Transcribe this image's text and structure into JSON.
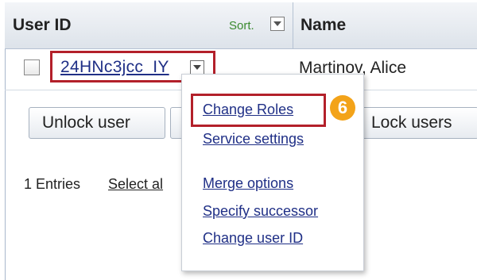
{
  "header": {
    "col_user_id": "User ID",
    "sort_label": "Sort.",
    "sort_icon": "dropdown-arrow-icon",
    "col_name": "Name"
  },
  "row": {
    "checkbox_checked": false,
    "user_id": "24HNc3jcc_IY",
    "user_id_menu_icon": "dropdown-arrow-icon",
    "name": "Martinov, Alice"
  },
  "buttons": {
    "unlock": "Unlock user",
    "lock": "Lock users"
  },
  "footer": {
    "entries": "1 Entries",
    "select_all": "Select al"
  },
  "context_menu": {
    "items": [
      "Change Roles",
      "Service settings",
      "Merge options",
      "Specify successor",
      "Change user ID"
    ]
  },
  "annotation": {
    "step": "6",
    "highlight_color": "#b3202a",
    "badge_color": "#f3a319"
  },
  "colors": {
    "link": "#1f2f86",
    "sort_label": "#3a8a2e"
  }
}
